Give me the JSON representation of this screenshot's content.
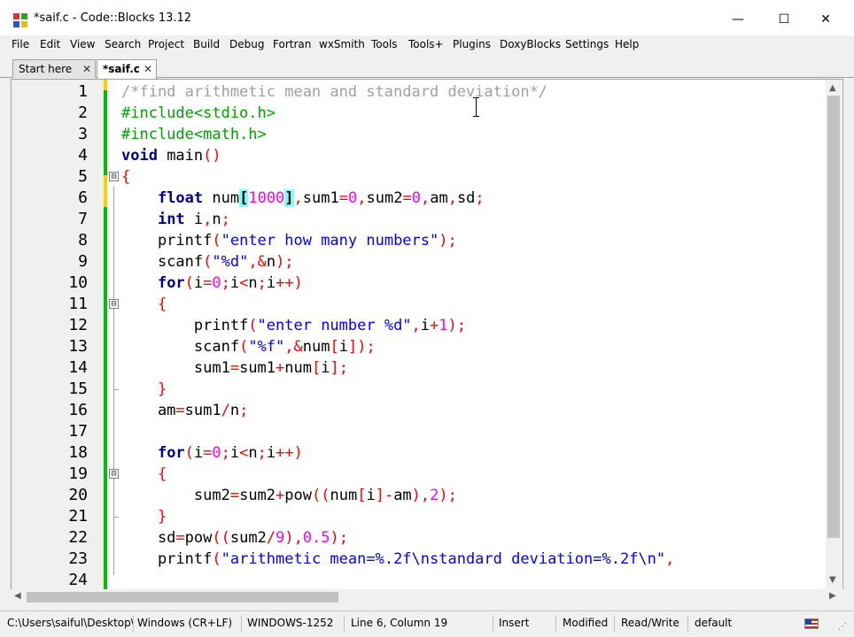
{
  "window": {
    "title": "*saif.c - Code::Blocks 13.12",
    "minimize_glyph": "—",
    "maximize_glyph": "☐",
    "close_glyph": "✕"
  },
  "menu": [
    "File",
    "Edit",
    "View",
    "Search",
    "Project",
    "Build",
    "Debug",
    "Fortran",
    "wxSmith",
    "Tools",
    "Tools+",
    "Plugins",
    "DoxyBlocks",
    "Settings",
    "Help"
  ],
  "tabs": [
    {
      "label": "Start here",
      "active": false
    },
    {
      "label": "*saif.c",
      "active": true
    }
  ],
  "editor": {
    "line_numbers": [
      "1",
      "2",
      "3",
      "4",
      "5",
      "6",
      "7",
      "8",
      "9",
      "10",
      "11",
      "12",
      "13",
      "14",
      "15",
      "16",
      "17",
      "18",
      "19",
      "20",
      "21",
      "22",
      "23",
      "24"
    ],
    "lines": [
      [
        {
          "t": "/*find arithmetic mean and standard deviation*/",
          "c": "comment"
        }
      ],
      [
        {
          "t": "#include<stdio.h>",
          "c": "pre"
        }
      ],
      [
        {
          "t": "#include<math.h>",
          "c": "pre"
        }
      ],
      [
        {
          "t": "void",
          "c": "kw"
        },
        {
          "t": " main",
          "c": ""
        },
        {
          "t": "()",
          "c": "op"
        }
      ],
      [
        {
          "t": "{",
          "c": "op"
        }
      ],
      [
        {
          "t": "    ",
          "c": ""
        },
        {
          "t": "float",
          "c": "kw"
        },
        {
          "t": " num",
          "c": ""
        },
        {
          "t": "[",
          "c": "brace"
        },
        {
          "t": "1000",
          "c": "num"
        },
        {
          "t": "]",
          "c": "brace"
        },
        {
          "t": ",",
          "c": "op"
        },
        {
          "t": "sum1",
          "c": ""
        },
        {
          "t": "=",
          "c": "op"
        },
        {
          "t": "0",
          "c": "num"
        },
        {
          "t": ",",
          "c": "op"
        },
        {
          "t": "sum2",
          "c": ""
        },
        {
          "t": "=",
          "c": "op"
        },
        {
          "t": "0",
          "c": "num"
        },
        {
          "t": ",",
          "c": "op"
        },
        {
          "t": "am",
          "c": ""
        },
        {
          "t": ",",
          "c": "op"
        },
        {
          "t": "sd",
          "c": ""
        },
        {
          "t": ";",
          "c": "op"
        }
      ],
      [
        {
          "t": "    ",
          "c": ""
        },
        {
          "t": "int",
          "c": "kw"
        },
        {
          "t": " i",
          "c": ""
        },
        {
          "t": ",",
          "c": "op"
        },
        {
          "t": "n",
          "c": ""
        },
        {
          "t": ";",
          "c": "op"
        }
      ],
      [
        {
          "t": "    printf",
          "c": ""
        },
        {
          "t": "(",
          "c": "op"
        },
        {
          "t": "\"enter how many numbers\"",
          "c": "str"
        },
        {
          "t": ");",
          "c": "op"
        }
      ],
      [
        {
          "t": "    scanf",
          "c": ""
        },
        {
          "t": "(",
          "c": "op"
        },
        {
          "t": "\"%d\"",
          "c": "str"
        },
        {
          "t": ",&",
          "c": "op"
        },
        {
          "t": "n",
          "c": ""
        },
        {
          "t": ");",
          "c": "op"
        }
      ],
      [
        {
          "t": "    ",
          "c": ""
        },
        {
          "t": "for",
          "c": "kw"
        },
        {
          "t": "(",
          "c": "op"
        },
        {
          "t": "i",
          "c": ""
        },
        {
          "t": "=",
          "c": "op"
        },
        {
          "t": "0",
          "c": "num"
        },
        {
          "t": ";",
          "c": "op"
        },
        {
          "t": "i",
          "c": ""
        },
        {
          "t": "<",
          "c": "op"
        },
        {
          "t": "n",
          "c": ""
        },
        {
          "t": ";",
          "c": "op"
        },
        {
          "t": "i",
          "c": ""
        },
        {
          "t": "++)",
          "c": "op"
        }
      ],
      [
        {
          "t": "    ",
          "c": ""
        },
        {
          "t": "{",
          "c": "op"
        }
      ],
      [
        {
          "t": "        printf",
          "c": ""
        },
        {
          "t": "(",
          "c": "op"
        },
        {
          "t": "\"enter number %d\"",
          "c": "str"
        },
        {
          "t": ",",
          "c": "op"
        },
        {
          "t": "i",
          "c": ""
        },
        {
          "t": "+",
          "c": "op"
        },
        {
          "t": "1",
          "c": "num"
        },
        {
          "t": ");",
          "c": "op"
        }
      ],
      [
        {
          "t": "        scanf",
          "c": ""
        },
        {
          "t": "(",
          "c": "op"
        },
        {
          "t": "\"%f\"",
          "c": "str"
        },
        {
          "t": ",&",
          "c": "op"
        },
        {
          "t": "num",
          "c": ""
        },
        {
          "t": "[",
          "c": "op"
        },
        {
          "t": "i",
          "c": ""
        },
        {
          "t": "]);",
          "c": "op"
        }
      ],
      [
        {
          "t": "        sum1",
          "c": ""
        },
        {
          "t": "=",
          "c": "op"
        },
        {
          "t": "sum1",
          "c": ""
        },
        {
          "t": "+",
          "c": "op"
        },
        {
          "t": "num",
          "c": ""
        },
        {
          "t": "[",
          "c": "op"
        },
        {
          "t": "i",
          "c": ""
        },
        {
          "t": "];",
          "c": "op"
        }
      ],
      [
        {
          "t": "    ",
          "c": ""
        },
        {
          "t": "}",
          "c": "op"
        }
      ],
      [
        {
          "t": "    am",
          "c": ""
        },
        {
          "t": "=",
          "c": "op"
        },
        {
          "t": "sum1",
          "c": ""
        },
        {
          "t": "/",
          "c": "op"
        },
        {
          "t": "n",
          "c": ""
        },
        {
          "t": ";",
          "c": "op"
        }
      ],
      [
        {
          "t": "",
          "c": ""
        }
      ],
      [
        {
          "t": "    ",
          "c": ""
        },
        {
          "t": "for",
          "c": "kw"
        },
        {
          "t": "(",
          "c": "op"
        },
        {
          "t": "i",
          "c": ""
        },
        {
          "t": "=",
          "c": "op"
        },
        {
          "t": "0",
          "c": "num"
        },
        {
          "t": ";",
          "c": "op"
        },
        {
          "t": "i",
          "c": ""
        },
        {
          "t": "<",
          "c": "op"
        },
        {
          "t": "n",
          "c": ""
        },
        {
          "t": ";",
          "c": "op"
        },
        {
          "t": "i",
          "c": ""
        },
        {
          "t": "++)",
          "c": "op"
        }
      ],
      [
        {
          "t": "    ",
          "c": ""
        },
        {
          "t": "{",
          "c": "op"
        }
      ],
      [
        {
          "t": "        sum2",
          "c": ""
        },
        {
          "t": "=",
          "c": "op"
        },
        {
          "t": "sum2",
          "c": ""
        },
        {
          "t": "+",
          "c": "op"
        },
        {
          "t": "pow",
          "c": ""
        },
        {
          "t": "((",
          "c": "op"
        },
        {
          "t": "num",
          "c": ""
        },
        {
          "t": "[",
          "c": "op"
        },
        {
          "t": "i",
          "c": ""
        },
        {
          "t": "]-",
          "c": "op"
        },
        {
          "t": "am",
          "c": ""
        },
        {
          "t": "),",
          "c": "op"
        },
        {
          "t": "2",
          "c": "num"
        },
        {
          "t": ");",
          "c": "op"
        }
      ],
      [
        {
          "t": "    ",
          "c": ""
        },
        {
          "t": "}",
          "c": "op"
        }
      ],
      [
        {
          "t": "    sd",
          "c": ""
        },
        {
          "t": "=",
          "c": "op"
        },
        {
          "t": "pow",
          "c": ""
        },
        {
          "t": "((",
          "c": "op"
        },
        {
          "t": "sum2",
          "c": ""
        },
        {
          "t": "/",
          "c": "op"
        },
        {
          "t": "9",
          "c": "num"
        },
        {
          "t": "),",
          "c": "op"
        },
        {
          "t": "0.5",
          "c": "num"
        },
        {
          "t": ");",
          "c": "op"
        }
      ],
      [
        {
          "t": "    printf",
          "c": ""
        },
        {
          "t": "(",
          "c": "op"
        },
        {
          "t": "\"arithmetic mean=%.2f\\nstandard deviation=%.2f\\n\"",
          "c": "str"
        },
        {
          "t": ",",
          "c": "op"
        }
      ],
      [
        {
          "t": "",
          "c": ""
        }
      ]
    ],
    "fold_markers": [
      "⊟",
      "⊟",
      "⊟"
    ],
    "colors": {
      "change_bar_saved": "#00c000",
      "change_bar_modified": "#ffd000",
      "brace_highlight": "#80ffff"
    }
  },
  "status": {
    "file_path": "C:\\Users\\saiful\\Desktop\\sa",
    "line_endings": "Windows (CR+LF)",
    "encoding": "WINDOWS-1252",
    "position": "Line 6, Column 19",
    "insert_mode": "Insert",
    "modified": "Modified",
    "access": "Read/Write",
    "profile": "default"
  }
}
